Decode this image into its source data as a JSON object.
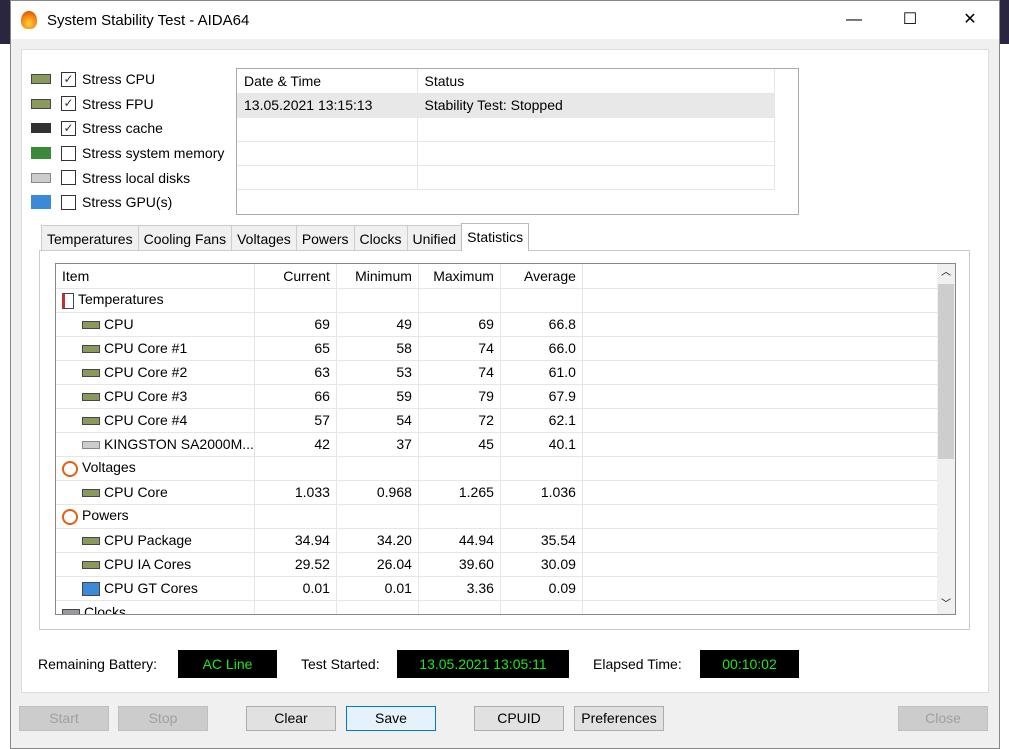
{
  "window": {
    "title": "System Stability Test - AIDA64",
    "minimize": "—",
    "maximize": "☐",
    "close": "✕"
  },
  "options": [
    {
      "label": "Stress CPU",
      "checked": true,
      "icon": "cpu-icon"
    },
    {
      "label": "Stress FPU",
      "checked": true,
      "icon": "fpu-icon"
    },
    {
      "label": "Stress cache",
      "checked": true,
      "icon": "cache-icon"
    },
    {
      "label": "Stress system memory",
      "checked": false,
      "icon": "memory-icon"
    },
    {
      "label": "Stress local disks",
      "checked": false,
      "icon": "disk-icon"
    },
    {
      "label": "Stress GPU(s)",
      "checked": false,
      "icon": "gpu-icon"
    }
  ],
  "log": {
    "headers": [
      "Date & Time",
      "Status"
    ],
    "rows": [
      [
        "13.05.2021 13:15:13",
        "Stability Test: Stopped"
      ]
    ]
  },
  "tabs": [
    "Temperatures",
    "Cooling Fans",
    "Voltages",
    "Powers",
    "Clocks",
    "Unified",
    "Statistics"
  ],
  "active_tab": "Statistics",
  "stats": {
    "headers": [
      "Item",
      "Current",
      "Minimum",
      "Maximum",
      "Average"
    ],
    "rows": [
      {
        "group": true,
        "icon": "thermometer-icon",
        "item": "Temperatures"
      },
      {
        "item": "CPU",
        "icon": "cpu-icon",
        "v": [
          "69",
          "49",
          "69",
          "66.8"
        ]
      },
      {
        "item": "CPU Core #1",
        "icon": "cpu-icon",
        "v": [
          "65",
          "58",
          "74",
          "66.0"
        ]
      },
      {
        "item": "CPU Core #2",
        "icon": "cpu-icon",
        "v": [
          "63",
          "53",
          "74",
          "61.0"
        ]
      },
      {
        "item": "CPU Core #3",
        "icon": "cpu-icon",
        "v": [
          "66",
          "59",
          "79",
          "67.9"
        ]
      },
      {
        "item": "CPU Core #4",
        "icon": "cpu-icon",
        "v": [
          "57",
          "54",
          "72",
          "62.1"
        ]
      },
      {
        "item": "KINGSTON SA2000M...",
        "icon": "disk-icon",
        "v": [
          "42",
          "37",
          "45",
          "40.1"
        ]
      },
      {
        "group": true,
        "icon": "lightning-icon",
        "item": "Voltages"
      },
      {
        "item": "CPU Core",
        "icon": "cpu-icon",
        "v": [
          "1.033",
          "0.968",
          "1.265",
          "1.036"
        ]
      },
      {
        "group": true,
        "icon": "lightning-icon",
        "item": "Powers"
      },
      {
        "item": "CPU Package",
        "icon": "cpu-icon",
        "v": [
          "34.94",
          "34.20",
          "44.94",
          "35.54"
        ]
      },
      {
        "item": "CPU IA Cores",
        "icon": "cpu-icon",
        "v": [
          "29.52",
          "26.04",
          "39.60",
          "30.09"
        ]
      },
      {
        "item": "CPU GT Cores",
        "icon": "gpu-icon",
        "v": [
          "0.01",
          "0.01",
          "3.36",
          "0.09"
        ]
      },
      {
        "group": true,
        "icon": "clock-icon",
        "item": "Clocks"
      }
    ]
  },
  "status": {
    "battery_label": "Remaining Battery:",
    "battery": "AC Line",
    "started_label": "Test Started:",
    "started": "13.05.2021 13:05:11",
    "elapsed_label": "Elapsed Time:",
    "elapsed": "00:10:02"
  },
  "buttons": {
    "start": "Start",
    "stop": "Stop",
    "clear": "Clear",
    "save": "Save",
    "cpuid": "CPUID",
    "preferences": "Preferences",
    "close": "Close"
  }
}
